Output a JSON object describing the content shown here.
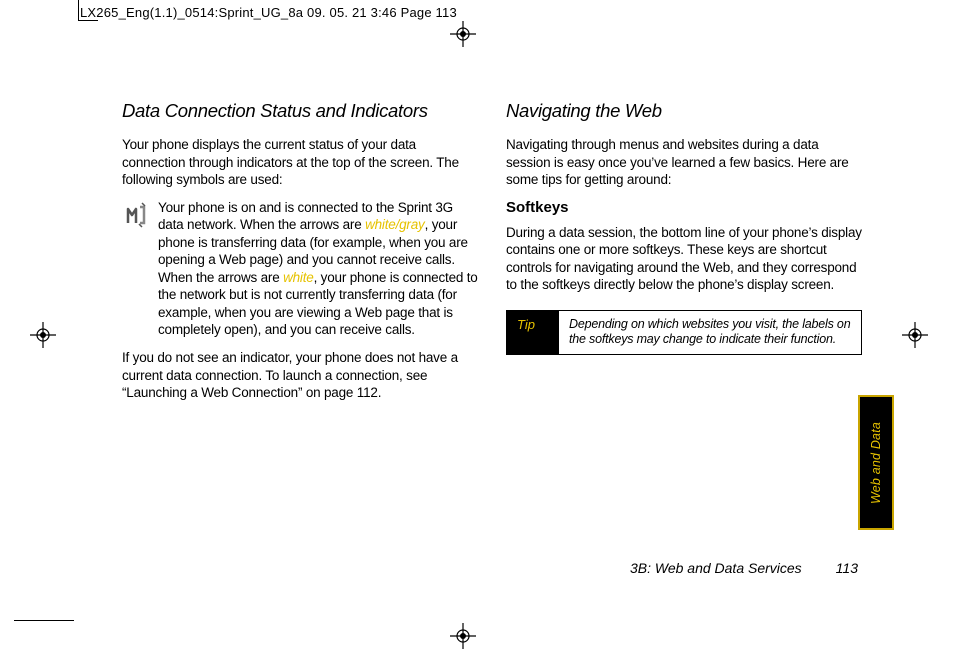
{
  "print_info": "LX265_Eng(1.1)_0514:Sprint_UG_8a  09. 05. 21    3:46  Page 113",
  "left_column": {
    "heading": "Data Connection Status and Indicators",
    "intro": "Your phone displays the current status of your data connection through indicators at the top of the screen. The following symbols are used:",
    "icon_desc_1a": "Your phone is on and is connected to the Sprint 3G data network. When the arrows are ",
    "accent_1": "white/gray",
    "icon_desc_1b": ", your phone is transferring data (for example, when you are opening a Web page) and you cannot receive calls. When the arrows are ",
    "accent_2": "white",
    "icon_desc_1c": ", your phone is connected to the network but is not currently transferring data (for example, when you are viewing a Web page that is completely open), and you can receive calls.",
    "outro": "If you do not see an indicator, your phone does not have a current data connection. To launch a connection, see “Launching a Web Connection” on page 112."
  },
  "right_column": {
    "heading": "Navigating the Web",
    "intro": "Navigating through menus and websites during a data session is easy once you’ve learned a few basics. Here are some tips for getting around:",
    "sub_heading": "Softkeys",
    "softkeys_text": "During a data session, the bottom line of your phone’s display contains one or more softkeys. These keys are shortcut controls for navigating around the Web, and they correspond to the softkeys directly below the phone’s display screen.",
    "tip_label": "Tip",
    "tip_text": "Depending on which websites you visit, the labels on the softkeys may change to indicate their function."
  },
  "side_tab": "Web and Data",
  "footer": {
    "section": "3B: Web and Data Services",
    "page": "113"
  }
}
